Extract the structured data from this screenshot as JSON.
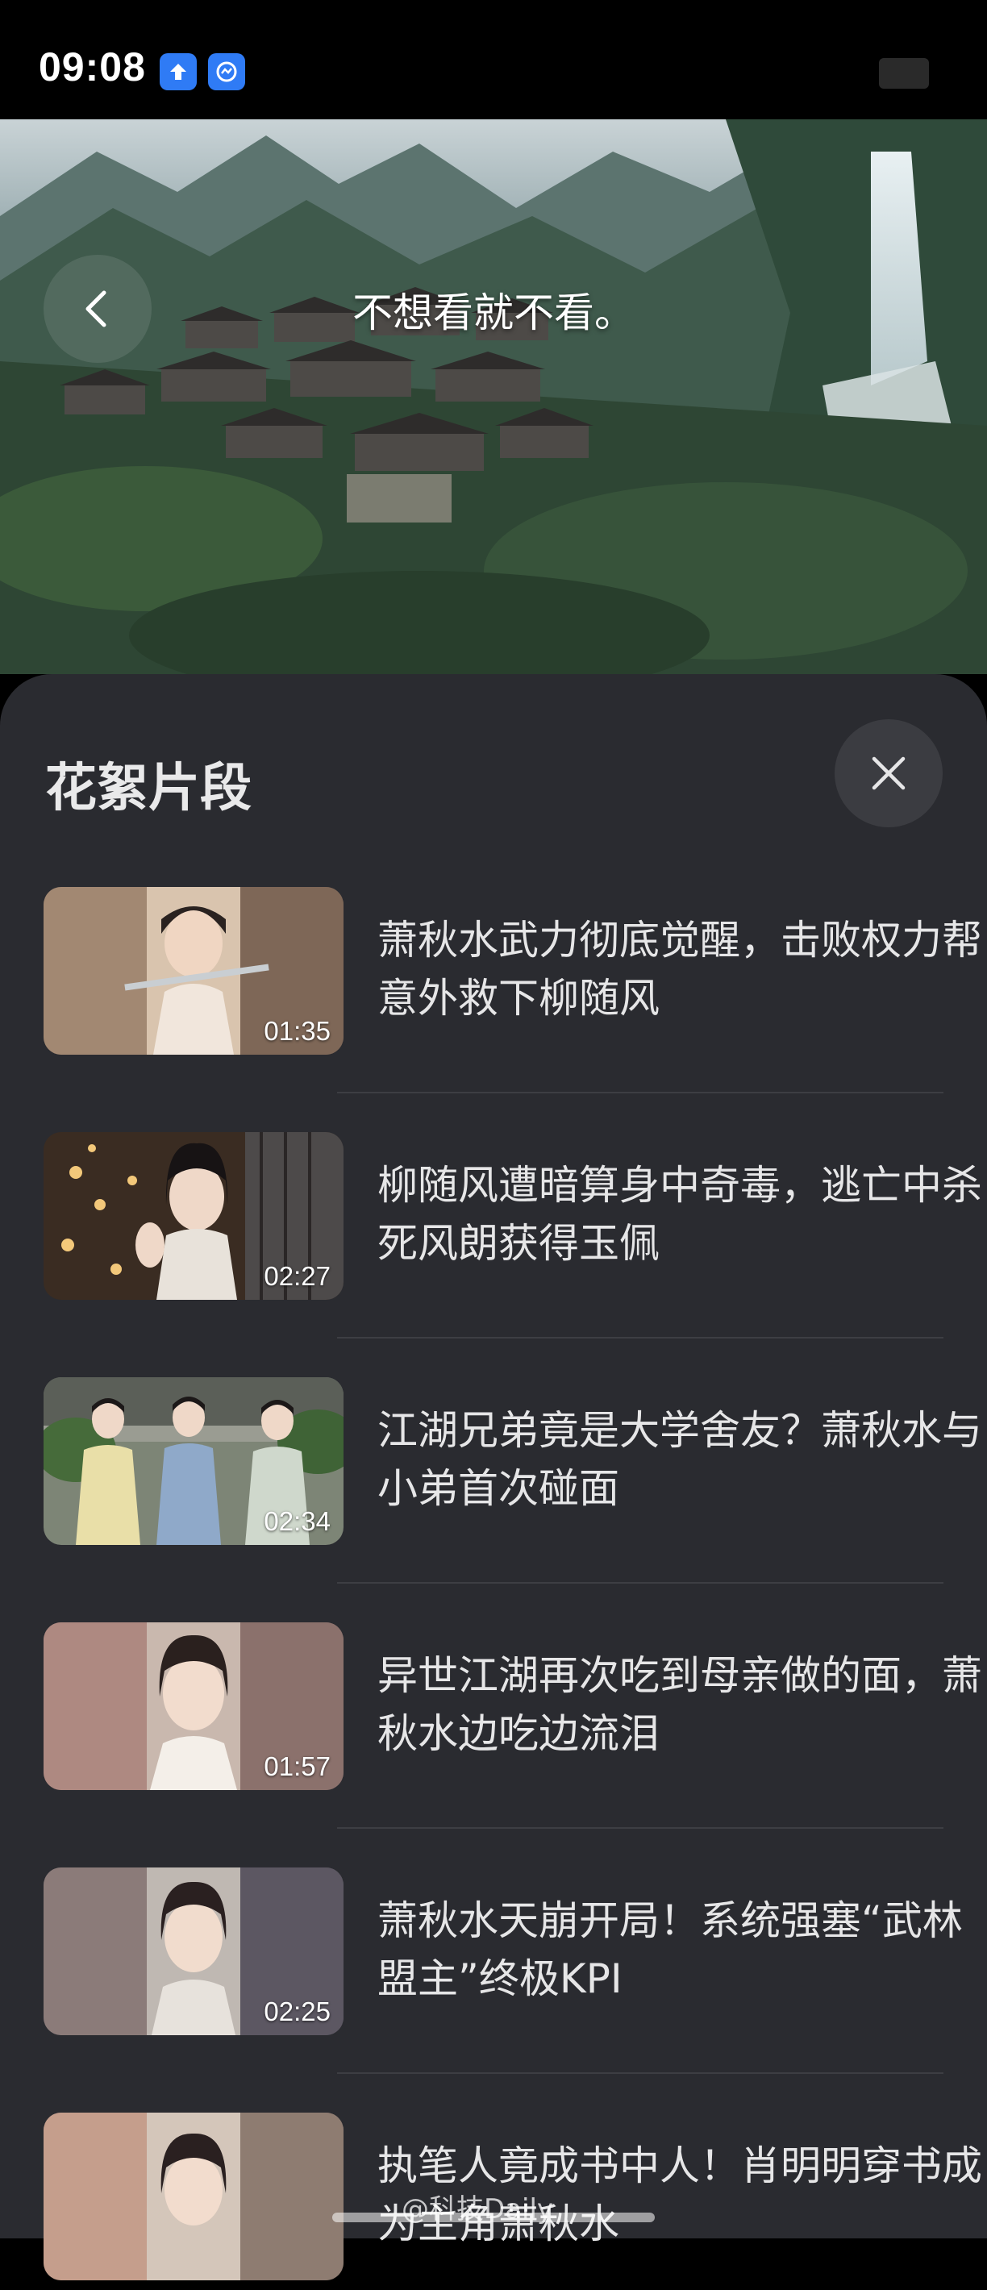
{
  "status_bar": {
    "time": "09:08"
  },
  "hero": {
    "title": "不想看就不看。"
  },
  "sheet": {
    "title": "花絮片段"
  },
  "clips": [
    {
      "title": "萧秋水武力彻底觉醒，击败权力帮意外救下柳随风",
      "duration": "01:35"
    },
    {
      "title": "柳随风遭暗算身中奇毒，逃亡中杀死风朗获得玉佩",
      "duration": "02:27"
    },
    {
      "title": "江湖兄弟竟是大学舍友？萧秋水与小弟首次碰面",
      "duration": "02:34"
    },
    {
      "title": "异世江湖再次吃到母亲做的面，萧秋水边吃边流泪",
      "duration": "01:57"
    },
    {
      "title": "萧秋水天崩开局！系统强塞“武林盟主”终极KPI",
      "duration": "02:25"
    },
    {
      "title": "执笔人竟成书中人！肖明明穿书成为主角萧秋水",
      "duration": ""
    }
  ],
  "watermark": "@科技Daily",
  "colors": {
    "sheet_bg": "#2a2b30",
    "text": "#e6e6e7",
    "accent_blue": "#2f7bf5"
  }
}
